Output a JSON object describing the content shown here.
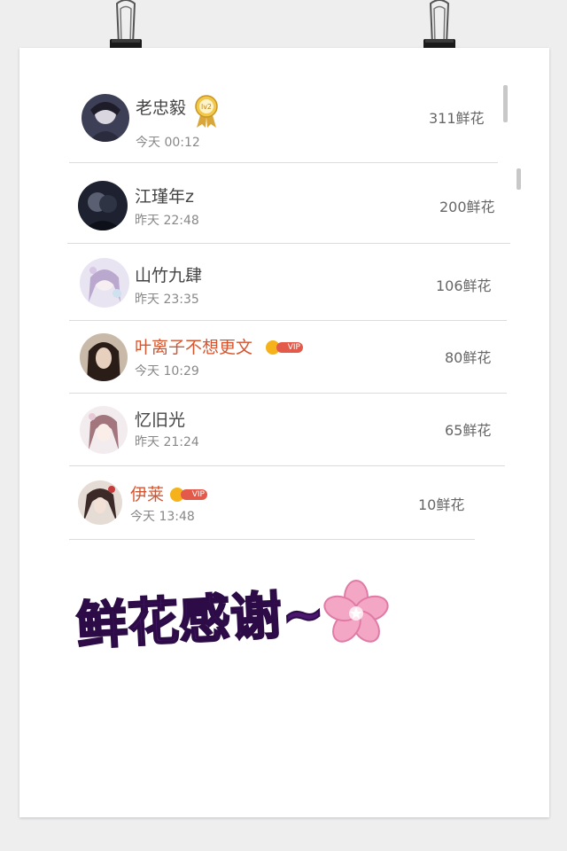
{
  "banner": {
    "text": "鲜花感谢~"
  },
  "vip_label": "VIP",
  "lv_badge_label": "lv2",
  "entries": [
    {
      "name": "老忠毅",
      "time": "今天 00:12",
      "amount": "311鲜花",
      "badge": "lv2"
    },
    {
      "name": "江瑾年z",
      "time": "昨天 22:48",
      "amount": "200鲜花",
      "badge": ""
    },
    {
      "name": "山竹九肆",
      "time": "昨天 23:35",
      "amount": "106鲜花",
      "badge": ""
    },
    {
      "name": "叶离子不想更文",
      "time": "今天 10:29",
      "amount": "80鲜花",
      "badge": "VIP"
    },
    {
      "name": "忆旧光",
      "time": "昨天 21:24",
      "amount": "65鲜花",
      "badge": ""
    },
    {
      "name": "伊莱",
      "time": "今天 13:48",
      "amount": "10鲜花",
      "badge": "VIP"
    }
  ],
  "colors": {
    "vip_name": "#d5552f",
    "banner_fill": "#4a1670",
    "sakura": "#f4a7c4"
  }
}
